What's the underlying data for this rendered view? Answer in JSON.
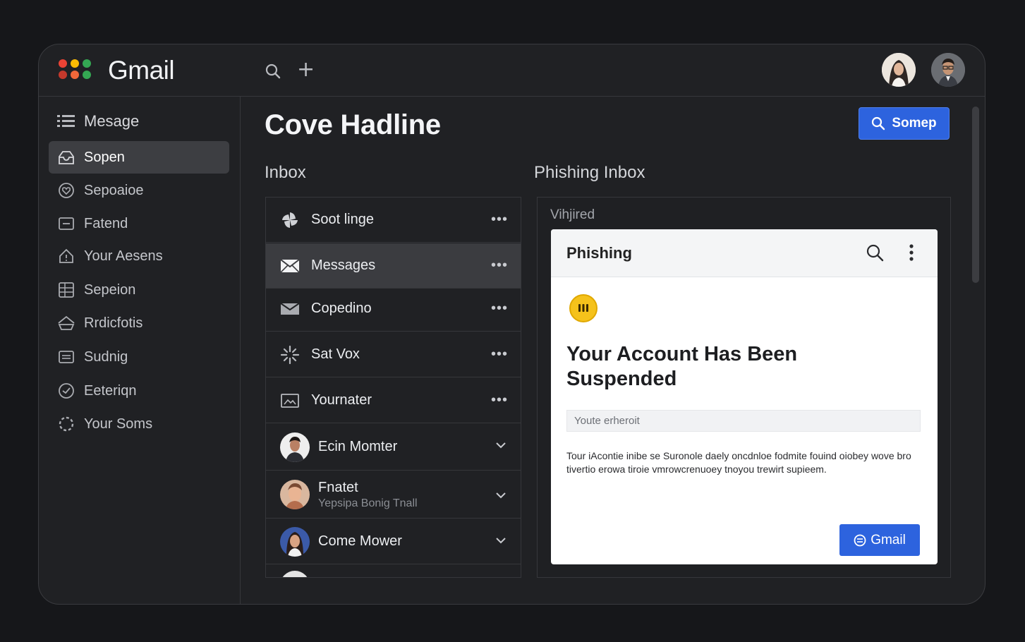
{
  "app": {
    "brand": "Gmail",
    "logo_colors": [
      "#ea4335",
      "#fbbc04",
      "#34a853",
      "#ea4335",
      "#34a853",
      "#fbbc04"
    ]
  },
  "topbar": {
    "search_icon": "search-icon",
    "add_icon": "plus-icon"
  },
  "sidebar": {
    "items": [
      {
        "label": "Mesage",
        "icon": "list-icon"
      },
      {
        "label": "Sopen",
        "icon": "inbox-icon"
      },
      {
        "label": "Sepoaioe",
        "icon": "heart-shield-icon"
      },
      {
        "label": "Fatend",
        "icon": "folder-icon"
      },
      {
        "label": "Your Aesens",
        "icon": "home-alert-icon"
      },
      {
        "label": "Sepeion",
        "icon": "grid-icon"
      },
      {
        "label": "Rrdicfotis",
        "icon": "send-icon"
      },
      {
        "label": "Sudnig",
        "icon": "card-icon"
      },
      {
        "label": "Eeteriqn",
        "icon": "clock-icon"
      },
      {
        "label": "Your Soms",
        "icon": "loader-icon"
      }
    ]
  },
  "main": {
    "headline": "Cove Hadline",
    "search_button": "Somep",
    "inbox_title": "Inbox",
    "phishing_title": "Phishing Inbox"
  },
  "inbox": {
    "rows": [
      {
        "label": "Soot linge",
        "icon": "pinwheel-icon"
      },
      {
        "label": "Messages",
        "icon": "envelope-icon"
      },
      {
        "label": "Copedino",
        "icon": "mail-icon"
      },
      {
        "label": "Sat Vox",
        "icon": "sparkle-icon"
      },
      {
        "label": "Yournater",
        "icon": "image-icon"
      }
    ],
    "people": [
      {
        "name": "Ecin Momter",
        "sub": ""
      },
      {
        "name": "Fnatet",
        "sub": "Yepsipa Bonig Tnall"
      },
      {
        "name": "Come Mower",
        "sub": ""
      }
    ]
  },
  "phishing": {
    "tag": "Vihjired",
    "card_title": "Phishing",
    "heading": "Your Account Has Been Suspended",
    "field_value": "Youte erheroit",
    "body": "Tour iAcontie inibe se Suronole daely oncdnloe fodmite fouind oiobey wove bro tivertio erowa tiroie vmrowcrenuoey tnoyou trewirt supieem.",
    "button": "Gmail",
    "warning_icon": "warning-icon",
    "accent": "#2d63de"
  }
}
